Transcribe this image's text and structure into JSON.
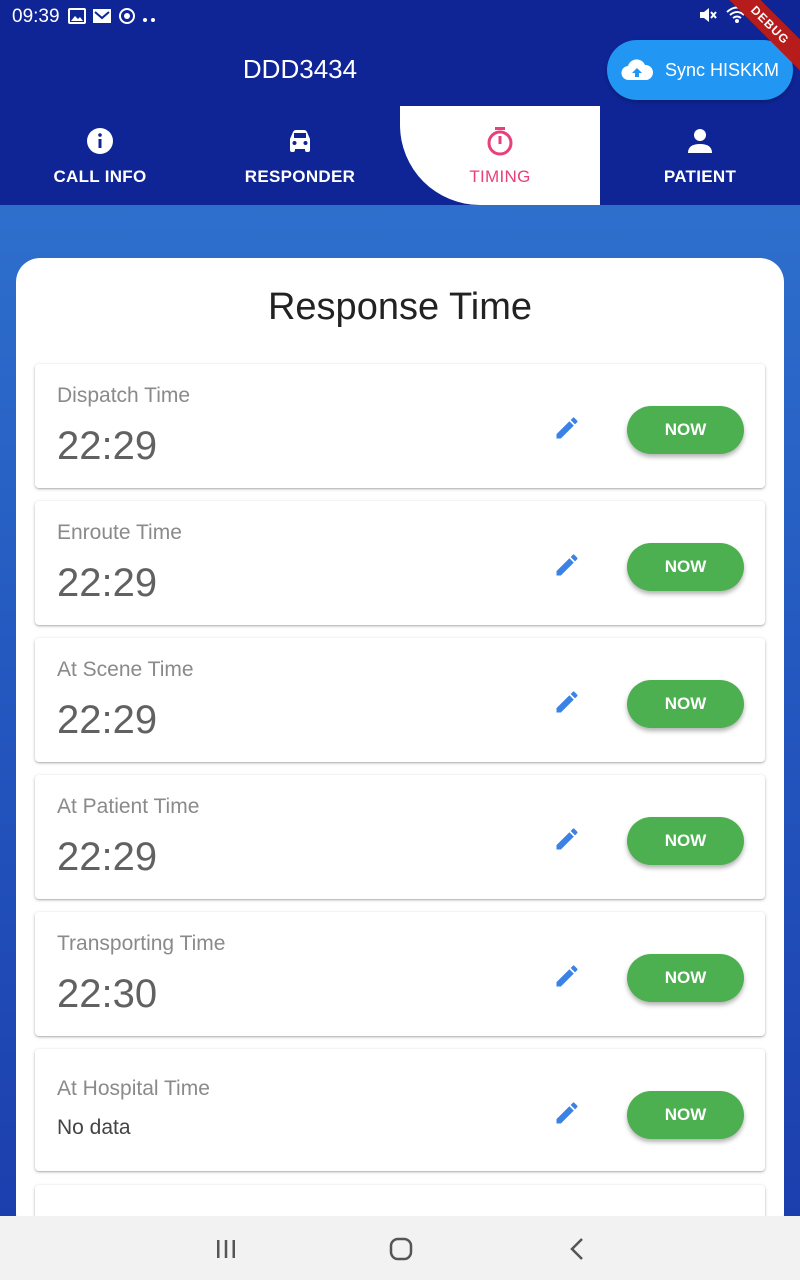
{
  "status_bar": {
    "time": "09:39",
    "left_icons": [
      "gallery-icon",
      "mail-icon",
      "sync-status-icon",
      "more-dots-icon"
    ],
    "right_icons": [
      "mute-icon",
      "wifi-icon",
      "battery-icon"
    ]
  },
  "debug_banner": "DEBUG",
  "app_bar": {
    "title": "DDD3434",
    "sync_button": {
      "label": "Sync HISKKM",
      "icon": "cloud-upload-icon"
    }
  },
  "tabs": [
    {
      "label": "CALL INFO",
      "icon": "info-icon",
      "active": false
    },
    {
      "label": "RESPONDER",
      "icon": "car-icon",
      "active": false
    },
    {
      "label": "TIMING",
      "icon": "timer-icon",
      "active": true
    },
    {
      "label": "PATIENT",
      "icon": "person-icon",
      "active": false
    }
  ],
  "colors": {
    "primary": "#0f2596",
    "active_tab_accent": "#e8407a",
    "sync_button": "#2196f3",
    "now_button": "#4caf50",
    "edit_icon": "#3b82e6"
  },
  "card": {
    "title": "Response Time",
    "rows": [
      {
        "label": "Dispatch Time",
        "value": "22:29",
        "button": "NOW"
      },
      {
        "label": "Enroute Time",
        "value": "22:29",
        "button": "NOW"
      },
      {
        "label": "At Scene Time",
        "value": "22:29",
        "button": "NOW"
      },
      {
        "label": "At Patient Time",
        "value": "22:29",
        "button": "NOW"
      },
      {
        "label": "Transporting Time",
        "value": "22:30",
        "button": "NOW"
      },
      {
        "label": "At Hospital Time",
        "value": "No data",
        "button": "NOW"
      }
    ]
  },
  "nav_bar": [
    "recents-icon",
    "home-icon",
    "back-icon"
  ]
}
